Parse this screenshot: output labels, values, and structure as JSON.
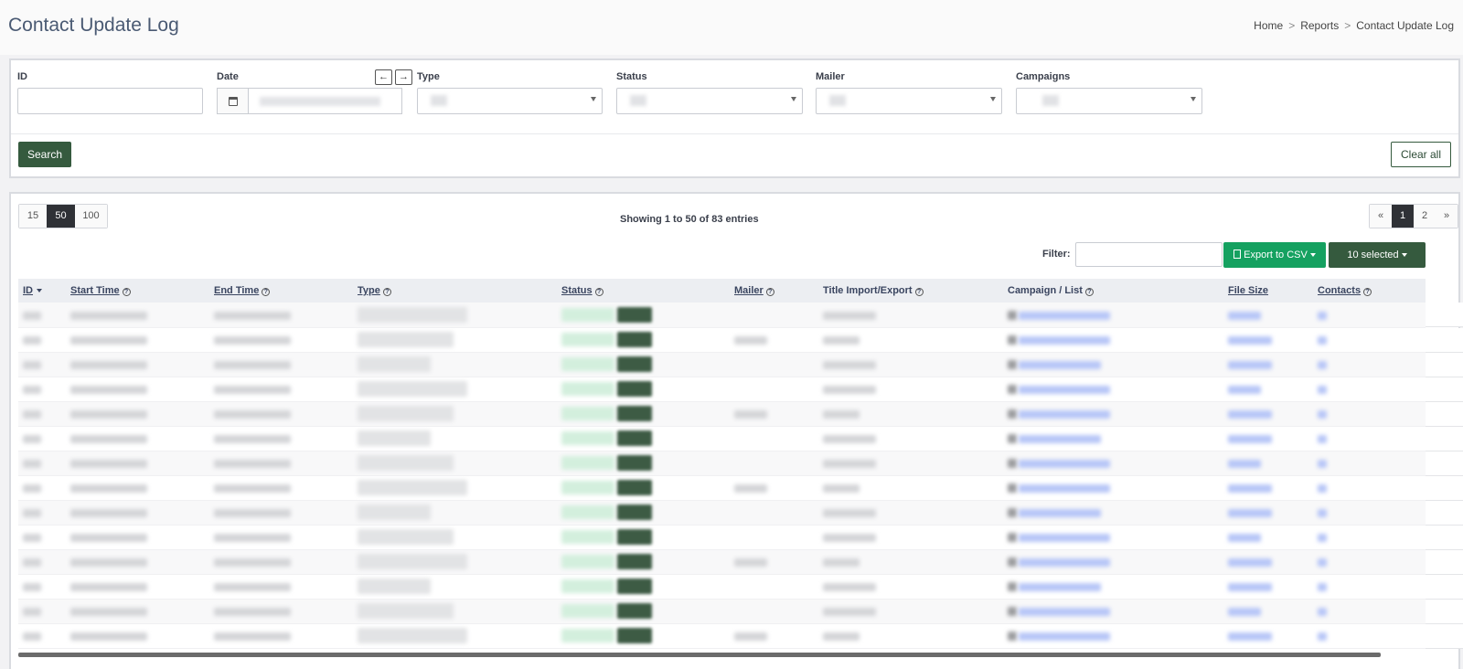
{
  "page": {
    "title": "Contact Update Log"
  },
  "breadcrumb": {
    "items": [
      "Home",
      "Reports",
      "Contact Update Log"
    ],
    "separator": ">"
  },
  "filters": {
    "id_label": "ID",
    "date_label": "Date",
    "type_label": "Type",
    "status_label": "Status",
    "mailer_label": "Mailer",
    "campaigns_label": "Campaigns",
    "prev_arrow": "←",
    "next_arrow": "→",
    "search_button": "Search",
    "clear_button": "Clear all"
  },
  "table_controls": {
    "page_sizes": [
      "15",
      "50",
      "100"
    ],
    "active_page_size": "50",
    "showing_text": "Showing 1 to 50 of 83 entries",
    "pager": [
      "«",
      "1",
      "2",
      "»"
    ],
    "active_page": "1",
    "filter_label": "Filter:",
    "export_button": "Export to CSV",
    "selected_button": "10 selected"
  },
  "table": {
    "columns": [
      "ID",
      "Start Time",
      "End Time",
      "Type",
      "Status",
      "Mailer",
      "Title Import/Export",
      "Campaign / List",
      "File Size",
      "Contacts"
    ],
    "row_count": 14
  },
  "colors": {
    "title": "#4a5a73",
    "primary_dark_green": "#355a3e",
    "export_green": "#15a160",
    "active_page": "#2f3136"
  }
}
